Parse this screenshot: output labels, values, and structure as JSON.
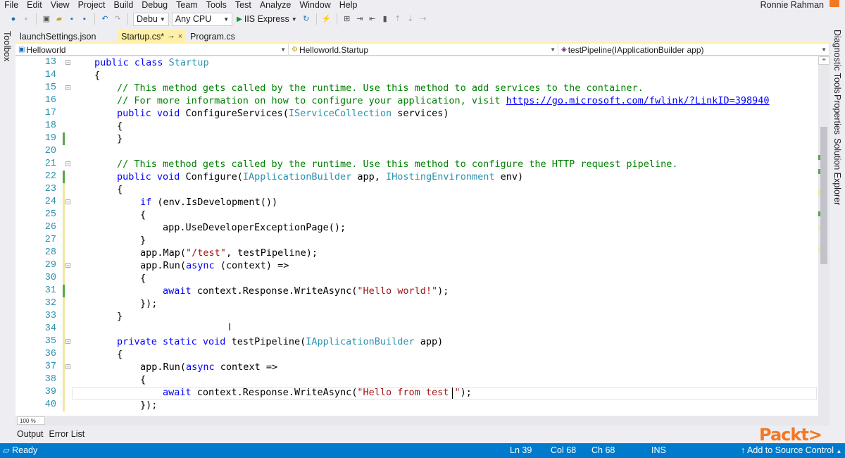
{
  "menu": [
    "File",
    "Edit",
    "View",
    "Project",
    "Build",
    "Debug",
    "Team",
    "Tools",
    "Test",
    "Analyze",
    "Window",
    "Help"
  ],
  "user": {
    "name": "Ronnie Rahman"
  },
  "toolbar": {
    "config_combo": "Debu",
    "platform_combo": "Any CPU",
    "run_target": "IIS Express"
  },
  "side_panels": {
    "left": "Toolbox",
    "right": [
      "Diagnostic Tools",
      "Properties",
      "Solution Explorer"
    ]
  },
  "doc_tabs": [
    {
      "label": "launchSettings.json",
      "state": "inactive"
    },
    {
      "label": "Startup.cs*",
      "state": "active"
    },
    {
      "label": "Program.cs",
      "state": "inactive"
    }
  ],
  "navbar": {
    "project": "Helloworld",
    "type": "Helloworld.Startup",
    "member": "testPipeline(IApplicationBuilder app)"
  },
  "editor": {
    "line_numbers": [
      "13",
      "14",
      "15",
      "16",
      "17",
      "18",
      "19",
      "20",
      "21",
      "22",
      "23",
      "24",
      "25",
      "26",
      "27",
      "28",
      "29",
      "30",
      "31",
      "32",
      "33",
      "34",
      "35",
      "36",
      "37",
      "38",
      "39",
      "40"
    ],
    "comment_15": "// This method gets called by the runtime. Use this method to add services to the container.",
    "comment_16": "// For more information on how to configure your application, visit ",
    "link_16": "https://go.microsoft.com/fwlink/?LinkID=398940",
    "comment_21": "// This method gets called by the runtime. Use this method to configure the HTTP request pipeline.",
    "str_test": "\"/test\"",
    "str_hello_world": "\"Hello world!\"",
    "str_hello_test": "\"Hello from test ",
    "str_hello_test_end": "\""
  },
  "zoom": "100 %",
  "output_tabs": [
    "Output",
    "Error List"
  ],
  "brand_logo": "Packt>",
  "status": {
    "ready": "Ready",
    "line": "Ln 39",
    "col": "Col 68",
    "ch": "Ch 68",
    "mode": "INS",
    "source_control": "Add to Source Control"
  },
  "colors": {
    "accent": "#007acc",
    "change_saved": "#57a64a",
    "change_unsaved": "#efe79f",
    "brand": "#f47721"
  }
}
